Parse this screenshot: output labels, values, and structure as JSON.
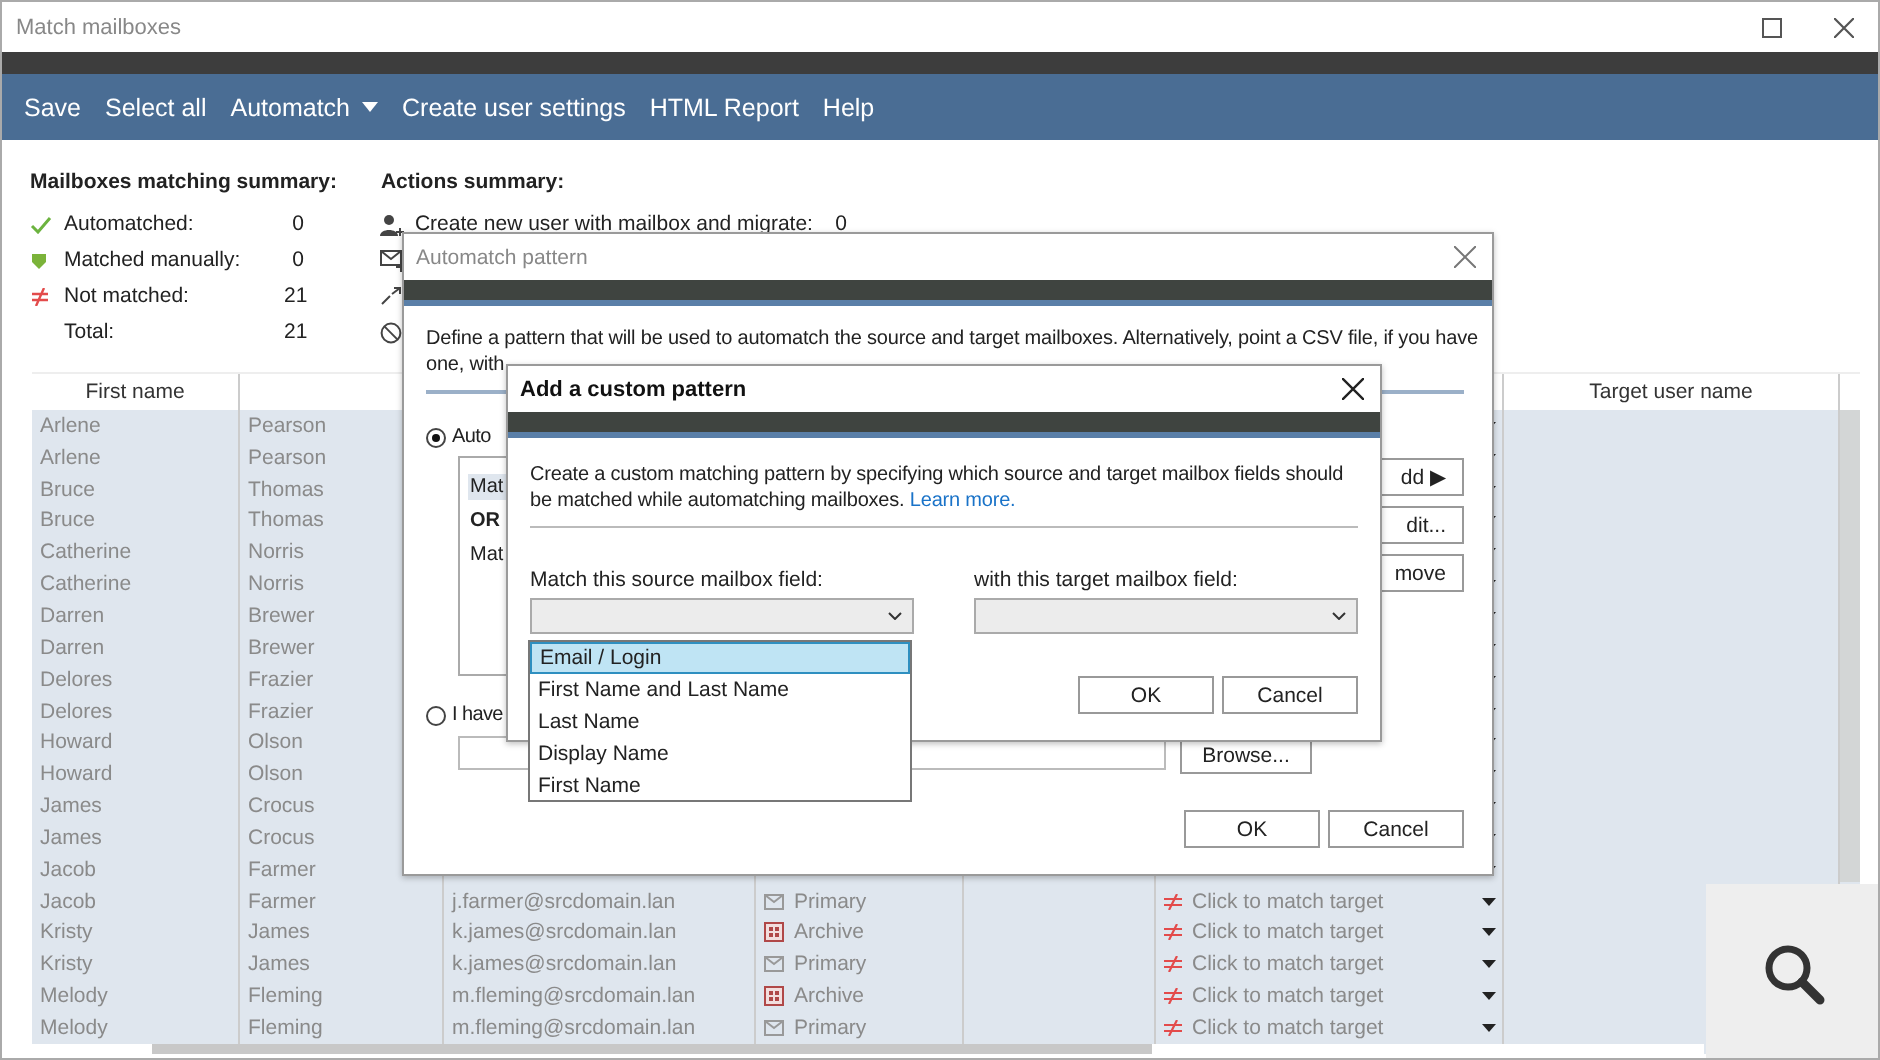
{
  "window": {
    "title": "Match mailboxes"
  },
  "toolbar": [
    {
      "label": "Save",
      "kind": "button"
    },
    {
      "label": "Select all",
      "kind": "button"
    },
    {
      "label": "Automatch",
      "kind": "menu"
    },
    {
      "label": "Create user settings",
      "kind": "button"
    },
    {
      "label": "HTML Report",
      "kind": "button"
    },
    {
      "label": "Help",
      "kind": "button"
    }
  ],
  "matching_summary": {
    "title": "Mailboxes matching summary:",
    "items": [
      {
        "kind": "automatched",
        "label": "Automatched:",
        "count": "0"
      },
      {
        "kind": "manual",
        "label": "Matched manually:",
        "count": "0"
      },
      {
        "kind": "not_matched",
        "label": "Not matched:",
        "count": "21"
      },
      {
        "kind": "total",
        "label": "Total:",
        "count": "21"
      }
    ]
  },
  "actions_summary": {
    "title": "Actions summary:",
    "items": [
      {
        "kind": "create_user",
        "label": "Create new user with mailbox and migrate:",
        "count": "0"
      },
      {
        "kind": "create_mailbox"
      },
      {
        "kind": "migrate"
      },
      {
        "kind": "skip"
      }
    ]
  },
  "table": {
    "columns": [
      {
        "label": "First name"
      },
      {},
      {},
      {},
      {},
      {},
      {
        "label": "Target user name"
      }
    ],
    "rows": [
      {
        "first": "Arlene",
        "last": "Pearson"
      },
      {
        "first": "Arlene",
        "last": "Pearson"
      },
      {
        "first": "Bruce",
        "last": "Thomas"
      },
      {
        "first": "Bruce",
        "last": "Thomas"
      },
      {
        "first": "Catherine",
        "last": "Norris"
      },
      {
        "first": "Catherine",
        "last": "Norris"
      },
      {
        "first": "Darren",
        "last": "Brewer"
      },
      {
        "first": "Darren",
        "last": "Brewer"
      },
      {
        "first": "Delores",
        "last": "Frazier"
      },
      {
        "first": "Delores",
        "last": "Frazier"
      },
      {
        "first": "Howard",
        "last": "Olson"
      },
      {
        "first": "Howard",
        "last": "Olson"
      },
      {
        "first": "James",
        "last": "Crocus"
      },
      {
        "first": "James",
        "last": "Crocus"
      },
      {
        "first": "Jacob",
        "last": "Farmer"
      },
      {
        "first": "Jacob",
        "last": "Farmer",
        "email": "j.farmer@srcdomain.lan",
        "type": {
          "kind": "primary",
          "label": "Primary"
        },
        "target": "Click to match target"
      },
      {
        "first": "Kristy",
        "last": "James",
        "email": "k.james@srcdomain.lan",
        "type": {
          "kind": "archive",
          "label": "Archive"
        },
        "target": "Click to match target"
      },
      {
        "first": "Kristy",
        "last": "James",
        "email": "k.james@srcdomain.lan",
        "type": {
          "kind": "primary",
          "label": "Primary"
        },
        "target": "Click to match target"
      },
      {
        "first": "Melody",
        "last": "Fleming",
        "email": "m.fleming@srcdomain.lan",
        "type": {
          "kind": "archive",
          "label": "Archive"
        },
        "target": "Click to match target"
      },
      {
        "first": "Melody",
        "last": "Fleming",
        "email": "m.fleming@srcdomain.lan",
        "type": {
          "kind": "primary",
          "label": "Primary"
        },
        "target": "Click to match target"
      }
    ]
  },
  "automatch_dialog": {
    "title": "Automatch pattern",
    "description": "Define a pattern that will be used to automatch the source and target mailboxes. Alternatively, point a CSV file, if you have one, with",
    "options": [
      {
        "label": "Auto",
        "selected": true
      },
      {
        "label": "I have",
        "selected": false
      }
    ],
    "patterns": [
      {
        "kind": "rule",
        "label": "Mat",
        "selected": true
      },
      {
        "kind": "operator",
        "label": "OR",
        "selected": false
      },
      {
        "kind": "rule",
        "label": "Mat",
        "selected": false
      }
    ],
    "side_buttons": [
      "dd ▶",
      "dit...",
      "move"
    ],
    "browse_button": "Browse...",
    "buttons": [
      "OK",
      "Cancel"
    ]
  },
  "custom_pattern_dialog": {
    "title": "Add a custom pattern",
    "description": "Create a custom matching pattern by specifying which source and target mailbox fields should be matched while automatching mailboxes.",
    "link": "Learn more.",
    "source_label": "Match this source mailbox field:",
    "target_label": "with this target mailbox field:",
    "source_options": [
      {
        "label": "Email / Login",
        "selected": true
      },
      {
        "label": "First Name and Last Name",
        "selected": false
      },
      {
        "label": "Last Name",
        "selected": false
      },
      {
        "label": "Display Name",
        "selected": false
      },
      {
        "label": "First Name",
        "selected": false
      }
    ],
    "buttons": [
      "OK",
      "Cancel"
    ]
  }
}
